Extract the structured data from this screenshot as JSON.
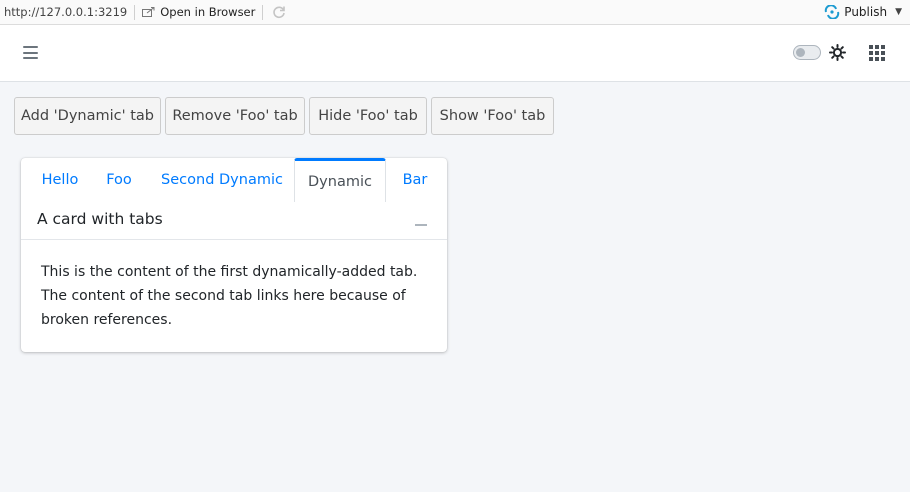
{
  "viewer": {
    "url": "http://127.0.0.1:3219",
    "open_in_browser": "Open in Browser",
    "publish": "Publish"
  },
  "navbar": {
    "menu_icon": "hamburger-icon",
    "theme_icon": "sun-icon",
    "apps_icon": "grid-icon"
  },
  "actions": {
    "add_dynamic": "Add 'Dynamic' tab",
    "remove_foo": "Remove 'Foo' tab",
    "hide_foo": "Hide 'Foo' tab",
    "show_foo": "Show 'Foo' tab"
  },
  "card": {
    "tabs": [
      {
        "label": "Hello"
      },
      {
        "label": "Foo"
      },
      {
        "label": "Second Dynamic"
      },
      {
        "label": "Dynamic",
        "active": true
      },
      {
        "label": "Bar"
      }
    ],
    "title": "A card with tabs",
    "body": "This is the content of the first dynamically-added tab. The content of the second tab links here because of broken references."
  },
  "colors": {
    "accent": "#007bff",
    "page_bg": "#f4f6f9",
    "publish_blue": "#1d9bd1"
  }
}
